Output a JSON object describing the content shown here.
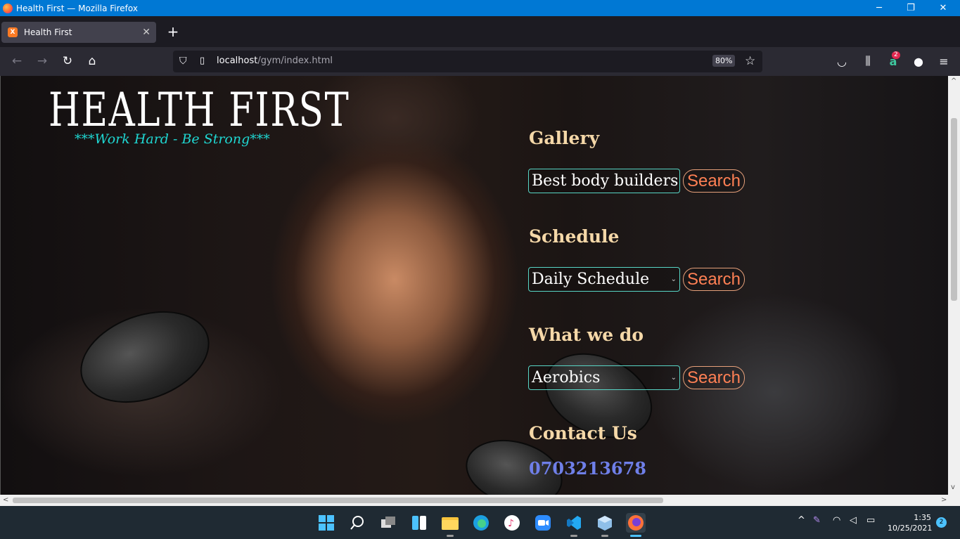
{
  "window": {
    "title": "Health First — Mozilla Firefox",
    "minimize": "─",
    "restore": "❐",
    "close": "✕"
  },
  "tab": {
    "title": "Health First",
    "favicon_text": "X",
    "close": "✕",
    "new_tab": "+"
  },
  "nav": {
    "back_icon": "←",
    "forward_icon": "→",
    "reload_icon": "↻",
    "home_icon": "⌂",
    "url_host": "localhost",
    "url_path": "/gym/index.html",
    "zoom": "80%",
    "shield_icon": "⛉",
    "page_icon": "▯",
    "star_icon": "☆"
  },
  "toolbar": {
    "pocket_icon": "◡",
    "library_icon": "⫼",
    "ext_badge": "2",
    "ext_icon": "a",
    "account_icon": "●",
    "menu_icon": "≡"
  },
  "page": {
    "logo": "HEALTH FIRST",
    "tagline": "***Work Hard - Be Strong***",
    "sections": [
      {
        "heading": "Gallery",
        "select_value": "Best body builders",
        "button": "Search"
      },
      {
        "heading": "Schedule",
        "select_value": "Daily Schedule",
        "button": "Search"
      },
      {
        "heading": "What we do",
        "select_value": "Aerobics",
        "button": "Search"
      }
    ],
    "contact_heading": "Contact Us",
    "phone": "0703213678"
  },
  "taskbar": {
    "time": "1:35",
    "date": "10/25/2021",
    "notifications": "2",
    "tray_chevron": "^",
    "icons": [
      "windows-start",
      "search",
      "task-view",
      "widgets",
      "file-explorer",
      "edge",
      "itunes",
      "zoom",
      "vscode",
      "virtualbox",
      "firefox"
    ]
  }
}
